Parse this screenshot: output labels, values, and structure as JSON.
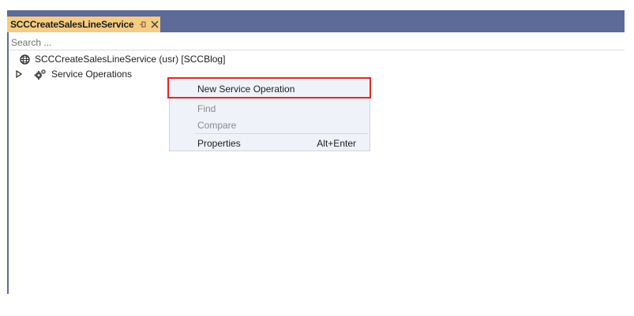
{
  "tab": {
    "title": "SCCCreateSalesLineService",
    "pin_icon": "pin-icon",
    "close_icon": "close-icon"
  },
  "search": {
    "placeholder": "Search ..."
  },
  "tree": {
    "root_label": "SCCCreateSalesLineService (usr) [SCCBlog]",
    "root_icon": "globe-icon",
    "child_label": "Service Operations",
    "child_icon": "gear-icon",
    "child_expander_icon": "expander-triangle-icon"
  },
  "context_menu": {
    "items": [
      {
        "label": "New Service Operation",
        "enabled": true
      },
      {
        "label": "Find",
        "enabled": false
      },
      {
        "label": "Compare",
        "enabled": false
      },
      {
        "label": "Properties",
        "shortcut": "Alt+Enter",
        "enabled": true
      }
    ]
  },
  "colors": {
    "tab_background": "#f5cc84",
    "frame_accent": "#5d6b99",
    "menu_background": "#f0f2fa",
    "highlight_border": "#e3262e"
  }
}
